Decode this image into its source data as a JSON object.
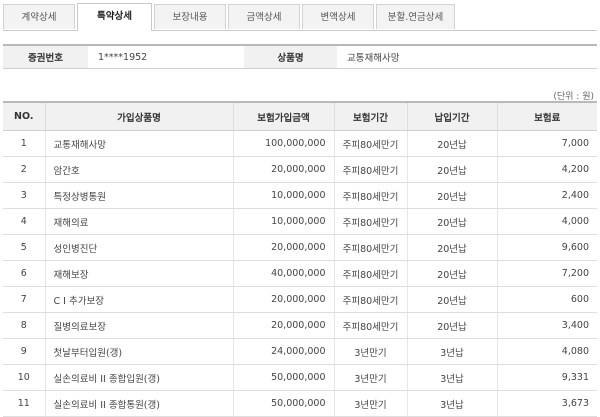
{
  "tabs": [
    {
      "label": "계약상세",
      "active": false
    },
    {
      "label": "특약상세",
      "active": true
    },
    {
      "label": "보장내용",
      "active": false
    },
    {
      "label": "금액상세",
      "active": false
    },
    {
      "label": "변액상세",
      "active": false
    },
    {
      "label": "분할.연금상세",
      "active": false
    }
  ],
  "info": {
    "policy_no_label": "증권번호",
    "policy_no_value": "1****1952",
    "product_label": "상품명",
    "product_value": "교통재해사망"
  },
  "unit": "(단위 : 원)",
  "table": {
    "headers": [
      "NO.",
      "가입상품명",
      "보험가입금액",
      "보험기간",
      "납입기간",
      "보험료"
    ],
    "rows": [
      {
        "no": "1",
        "name": "교통재해사망",
        "amount": "100,000,000",
        "term": "주피80세만기",
        "pay": "20년납",
        "premium": "7,000"
      },
      {
        "no": "2",
        "name": "암간호",
        "amount": "20,000,000",
        "term": "주피80세만기",
        "pay": "20년납",
        "premium": "4,200"
      },
      {
        "no": "3",
        "name": "특정상병통원",
        "amount": "10,000,000",
        "term": "주피80세만기",
        "pay": "20년납",
        "premium": "2,400"
      },
      {
        "no": "4",
        "name": "재해의료",
        "amount": "10,000,000",
        "term": "주피80세만기",
        "pay": "20년납",
        "premium": "4,000"
      },
      {
        "no": "5",
        "name": "성인병진단",
        "amount": "20,000,000",
        "term": "주피80세만기",
        "pay": "20년납",
        "premium": "9,600"
      },
      {
        "no": "6",
        "name": "재해보장",
        "amount": "40,000,000",
        "term": "주피80세만기",
        "pay": "20년납",
        "premium": "7,200"
      },
      {
        "no": "7",
        "name": "C I 추가보장",
        "amount": "20,000,000",
        "term": "주피80세만기",
        "pay": "20년납",
        "premium": "600"
      },
      {
        "no": "8",
        "name": "질병의료보장",
        "amount": "20,000,000",
        "term": "주피80세만기",
        "pay": "20년납",
        "premium": "3,400"
      },
      {
        "no": "9",
        "name": "첫날부터입원(갱)",
        "amount": "24,000,000",
        "term": "3년만기",
        "pay": "3년납",
        "premium": "4,080"
      },
      {
        "no": "10",
        "name": "실손의료비 II 종합입원(갱)",
        "amount": "50,000,000",
        "term": "3년만기",
        "pay": "3년납",
        "premium": "9,331"
      },
      {
        "no": "11",
        "name": "실손의료비 II 종합통원(갱)",
        "amount": "50,000,000",
        "term": "3년만기",
        "pay": "3년납",
        "premium": "3,673"
      }
    ]
  },
  "colors": {
    "accent_red": "#c4341a",
    "header_bg": "#f1f1f1"
  }
}
